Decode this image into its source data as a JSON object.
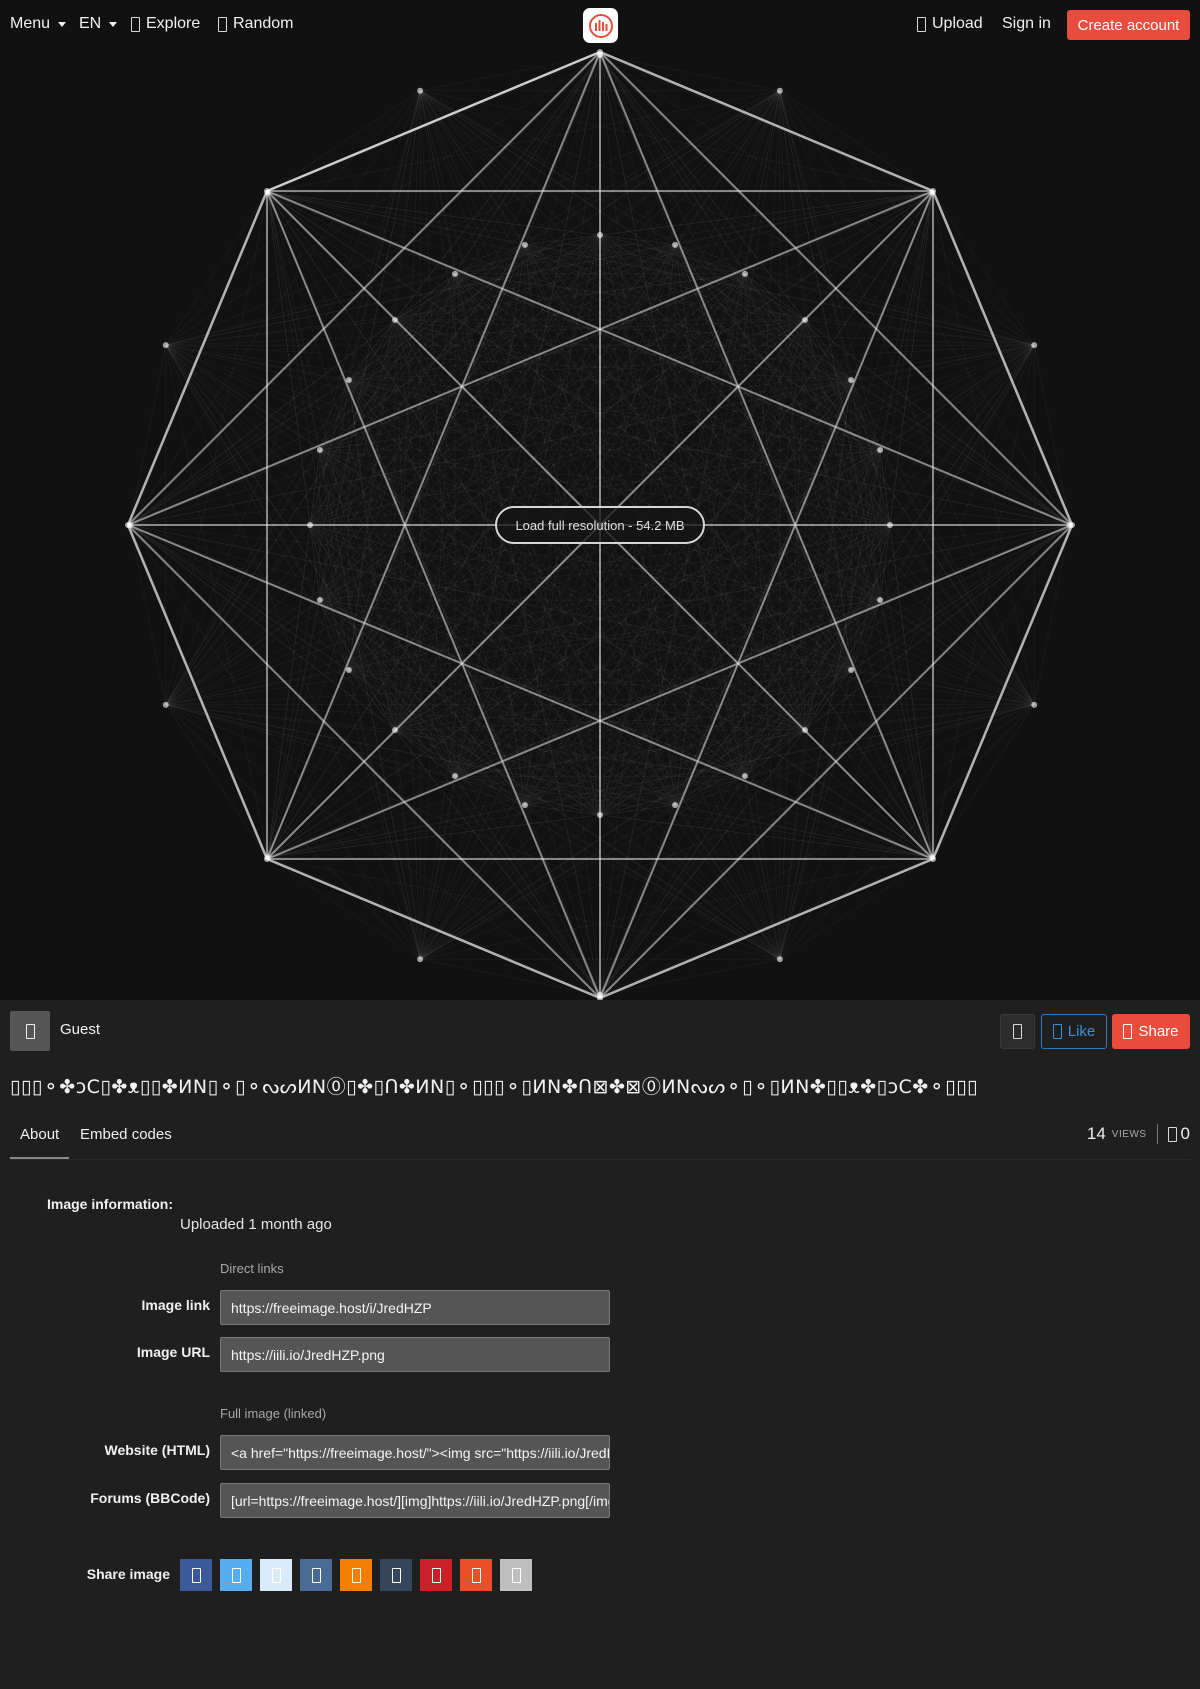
{
  "nav": {
    "menu_label": "Menu",
    "language_label": "EN",
    "explore_label": "Explore",
    "random_label": "Random",
    "upload_label": "Upload",
    "signin_label": "Sign in",
    "create_account_label": "Create account"
  },
  "viewer": {
    "load_full_label": "Load full resolution - 54.2 MB"
  },
  "owner": {
    "name": "Guest",
    "like_label": "Like",
    "share_label": "Share"
  },
  "image_title": "▯▯▯⚬✤ↄC▯✤ᴥ▯▯✤ИN▯⚬▯⚬ᔓᔕИN⓪▯✤▯ᑎ✤ИN▯⚬▯▯▯⚬▯ИN✤ᑎ⊠✤⊠⓪ИNᔓᔕ⚬▯⚬▯ИN✤▯▯ᴥ✤▯ↄC✤⚬▯▯▯",
  "tabs": {
    "about_label": "About",
    "embed_label": "Embed codes"
  },
  "stats": {
    "views_count": "14",
    "views_label": "VIEWS",
    "likes_count": "0"
  },
  "about": {
    "info_label": "Image information:",
    "uploaded_text": "Uploaded 1 month ago",
    "direct_links_label": "Direct links",
    "image_link_label": "Image link",
    "image_link_value": "https://freeimage.host/i/JredHZP",
    "image_url_label": "Image URL",
    "image_url_value": "https://iili.io/JredHZP.png",
    "full_image_label": "Full image (linked)",
    "html_label": "Website (HTML)",
    "html_value": "<a href=\"https://freeimage.host/\"><img src=\"https://iili.io/JredHZP.png\" alt=\"JredHZP.png\" border=\"0\" /></a>",
    "bbcode_label": "Forums (BBCode)",
    "bbcode_value": "[url=https://freeimage.host/][img]https://iili.io/JredHZP.png[/img][/url]",
    "share_image_label": "Share image"
  },
  "share_buttons": [
    {
      "name": "facebook-icon",
      "color": "#3b5998"
    },
    {
      "name": "twitter-icon",
      "color": "#55acee"
    },
    {
      "name": "bluesky-icon",
      "color": "#d9ebfb"
    },
    {
      "name": "vk-icon",
      "color": "#4a6a96"
    },
    {
      "name": "blogger-icon",
      "color": "#f57d00"
    },
    {
      "name": "tumblr-icon",
      "color": "#35465c"
    },
    {
      "name": "pinterest-icon",
      "color": "#cb2027"
    },
    {
      "name": "reddit-icon",
      "color": "#ea4f2a"
    },
    {
      "name": "email-icon",
      "color": "#bfbfbf"
    }
  ],
  "colors": {
    "accent": "#e84c3d",
    "like_blue": "#3b8fd6",
    "viewer_bg": "#111111",
    "page_bg": "#1f1f1f"
  }
}
